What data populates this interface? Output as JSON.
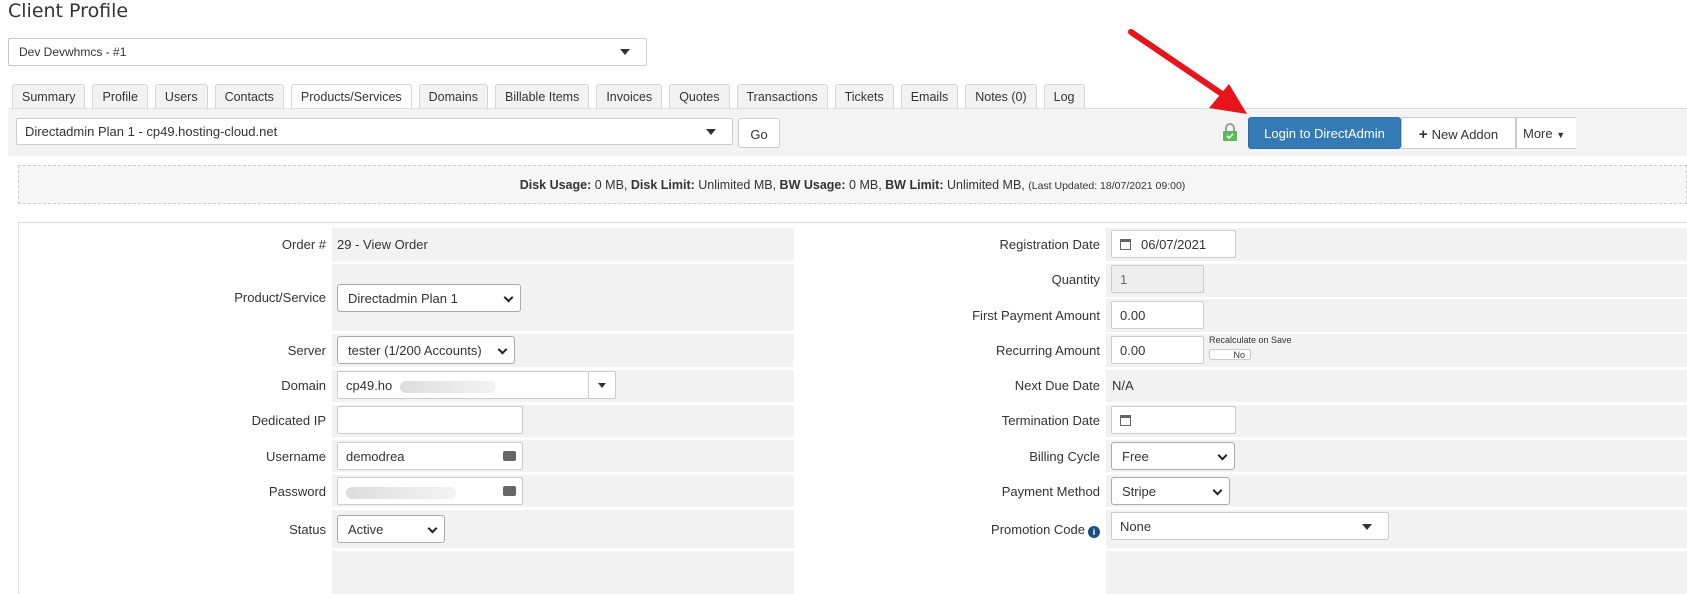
{
  "page": {
    "title": "Client Profile"
  },
  "client_select": {
    "value": "Dev Devwhmcs - #1"
  },
  "tabs": [
    {
      "label": "Summary"
    },
    {
      "label": "Profile"
    },
    {
      "label": "Users"
    },
    {
      "label": "Contacts"
    },
    {
      "label": "Products/Services",
      "active": true
    },
    {
      "label": "Domains"
    },
    {
      "label": "Billable Items"
    },
    {
      "label": "Invoices"
    },
    {
      "label": "Quotes"
    },
    {
      "label": "Transactions"
    },
    {
      "label": "Tickets"
    },
    {
      "label": "Emails"
    },
    {
      "label": "Notes (0)"
    },
    {
      "label": "Log"
    }
  ],
  "service_bar": {
    "service_select": "Directadmin Plan 1 - cp49.hosting-cloud.net",
    "go_label": "Go",
    "login_label": "Login to DirectAdmin",
    "addon_label": "New Addon",
    "more_label": "More"
  },
  "usage": {
    "disk_usage_label": "Disk Usage:",
    "disk_usage": "0 MB,",
    "disk_limit_label": "Disk Limit:",
    "disk_limit": "Unlimited MB,",
    "bw_usage_label": "BW Usage:",
    "bw_usage": "0 MB,",
    "bw_limit_label": "BW Limit:",
    "bw_limit": "Unlimited MB,",
    "last_updated": "(Last Updated: 18/07/2021 09:00)"
  },
  "left": {
    "order_label": "Order #",
    "order_value": "29 - View Order",
    "product_label": "Product/Service",
    "product_value": "Directadmin Plan 1",
    "server_label": "Server",
    "server_value": "tester (1/200 Accounts)",
    "domain_label": "Domain",
    "domain_value": "cp49.ho",
    "dedicated_ip_label": "Dedicated IP",
    "dedicated_ip_value": "",
    "username_label": "Username",
    "username_value": "demodrea",
    "password_label": "Password",
    "status_label": "Status",
    "status_value": "Active"
  },
  "right": {
    "reg_date_label": "Registration Date",
    "reg_date_value": "06/07/2021",
    "quantity_label": "Quantity",
    "quantity_value": "1",
    "first_payment_label": "First Payment Amount",
    "first_payment_value": "0.00",
    "recurring_label": "Recurring Amount",
    "recurring_value": "0.00",
    "recalc_label": "Recalculate on Save",
    "recalc_toggle": "No",
    "next_due_label": "Next Due Date",
    "next_due_value": "N/A",
    "termination_label": "Termination Date",
    "termination_value": "",
    "billing_cycle_label": "Billing Cycle",
    "billing_cycle_value": "Free",
    "payment_method_label": "Payment Method",
    "payment_method_value": "Stripe",
    "promo_label": "Promotion Code",
    "promo_value": "None"
  },
  "colors": {
    "primary_button": "#337ab7",
    "annotation_arrow": "#e8141b",
    "lock_green": "#5cb85c"
  }
}
